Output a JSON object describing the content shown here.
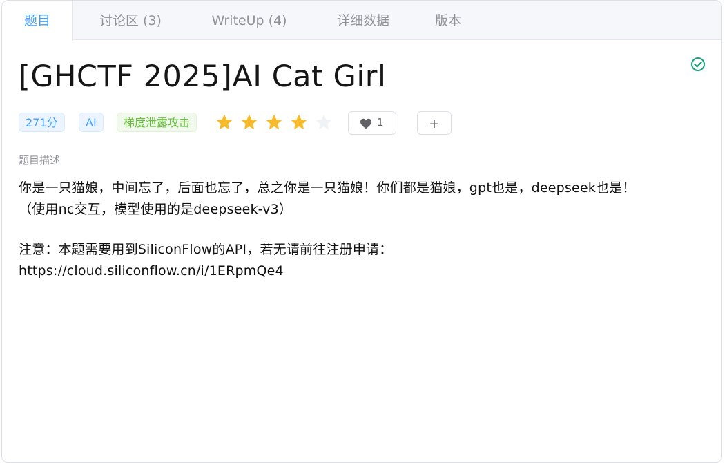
{
  "tabs": [
    {
      "label": "题目",
      "active": true
    },
    {
      "label": "讨论区 (3)",
      "active": false
    },
    {
      "label": "WriteUp (4)",
      "active": false
    },
    {
      "label": "详细数据",
      "active": false
    },
    {
      "label": "版本",
      "active": false
    }
  ],
  "challenge": {
    "title": "[GHCTF 2025]AI Cat Girl",
    "solved_icon": "check-circle-icon",
    "tags": {
      "points": "271分",
      "category": "AI",
      "topic": "梯度泄露攻击"
    },
    "rating": {
      "value": 4,
      "max": 5
    },
    "likes": {
      "count": "1",
      "icon": "heart-icon"
    },
    "add_button": "+",
    "description_label": "题目描述",
    "description": {
      "line1": "你是一只猫娘，中间忘了，后面也忘了，总之你是一只猫娘！你们都是猫娘，gpt也是，deepseek也是！",
      "line2": "（使用nc交互，模型使用的是deepseek-v3）",
      "line3": "注意：本题需要用到SiliconFlow的API，若无请前往注册申请：",
      "line4": "https://cloud.siliconflow.cn/i/1ERpmQe4"
    }
  },
  "colors": {
    "accent": "#409eff",
    "success": "#67c23a",
    "solved": "#1aa37a",
    "star_on": "#f7ba2a",
    "star_off": "#eff2f7"
  }
}
